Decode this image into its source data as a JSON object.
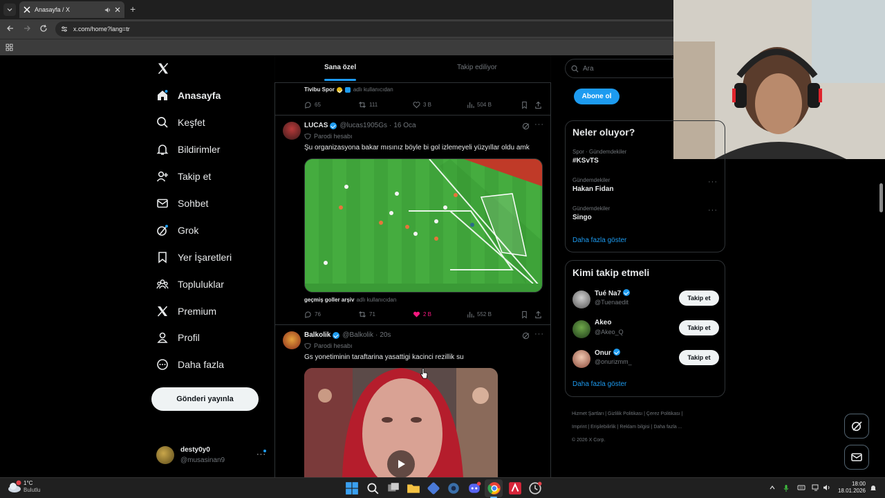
{
  "browser": {
    "tab_title": "Anasayfa / X",
    "url": "x.com/home?lang=tr"
  },
  "nav": {
    "items": [
      {
        "label": "Anasayfa",
        "icon": "home-icon"
      },
      {
        "label": "Keşfet",
        "icon": "search-icon"
      },
      {
        "label": "Bildirimler",
        "icon": "bell-icon"
      },
      {
        "label": "Takip et",
        "icon": "add-person-icon"
      },
      {
        "label": "Sohbet",
        "icon": "mail-icon"
      },
      {
        "label": "Grok",
        "icon": "grok-icon"
      },
      {
        "label": "Yer İşaretleri",
        "icon": "bookmark-icon"
      },
      {
        "label": "Topluluklar",
        "icon": "communities-icon"
      },
      {
        "label": "Premium",
        "icon": "x-logo-icon"
      },
      {
        "label": "Profil",
        "icon": "person-icon"
      },
      {
        "label": "Daha fazla",
        "icon": "more-circle-icon"
      }
    ],
    "post_button": "Gönderi yayınla",
    "account": {
      "name": "desty0y0",
      "handle": "@musasinan9"
    }
  },
  "timeline": {
    "tabs": [
      "Sana özel",
      "Takip ediliyor"
    ],
    "top_tweet": {
      "source": "Tivibu Spor",
      "source_suffix": "adlı kullanıcıdan",
      "replies": "65",
      "reposts": "111",
      "likes": "3 B",
      "views": "504 B"
    },
    "tweet1": {
      "name": "LUCAS",
      "handle": "@lucas1905Gs",
      "time": "16 Oca",
      "parody": "Parodi hesabı",
      "text": "Şu organizasyona bakar mısınız böyle bi gol izlemeyeli yüzyıllar oldu amk",
      "video_source": "geçmiş goller arşiv",
      "video_source_suffix": "adlı kullanıcıdan",
      "replies": "76",
      "reposts": "71",
      "likes": "2 B",
      "views": "552 B"
    },
    "tweet2": {
      "name": "Balkolik",
      "handle": "@Balkolik",
      "time": "20s",
      "parody": "Parodi hesabı",
      "text": "Gs yonetiminin taraftarina yasattigi kacinci rezillik su"
    }
  },
  "right": {
    "search_placeholder": "Ara",
    "subscribe": "Abone ol",
    "trends_title": "Neler oluyor?",
    "trends": [
      {
        "category": "Spor · Gündemdekiler",
        "name": "#KSvTS"
      },
      {
        "category": "Gündemdekiler",
        "name": "Hakan Fidan"
      },
      {
        "category": "Gündemdekiler",
        "name": "Singo"
      }
    ],
    "show_more": "Daha fazla göster",
    "who_title": "Kimi takip etmeli",
    "who": [
      {
        "name": "Tué Na7",
        "handle": "@Tuenaedit",
        "button": "Takip et"
      },
      {
        "name": "Akeo",
        "handle": "@Akeo_Q",
        "button": "Takip et"
      },
      {
        "name": "Onur",
        "handle": "@onurizmm_",
        "button": "Takip et"
      }
    ],
    "who_show_more": "Daha fazla göster",
    "footer": [
      "Hizmet Şartları",
      "Gizlilik Politikası",
      "Çerez Politikası",
      "Imprint",
      "Erişilebilirlik",
      "Reklam bilgisi",
      "Daha fazla ...",
      "© 2026 X Corp."
    ]
  },
  "taskbar": {
    "weather_temp": "1°C",
    "weather_desc": "Bulutlu",
    "time": "18:00",
    "date": "18.01.2026"
  },
  "colors": {
    "accent": "#1d9bf0",
    "like": "#f91880",
    "background": "#000000"
  }
}
